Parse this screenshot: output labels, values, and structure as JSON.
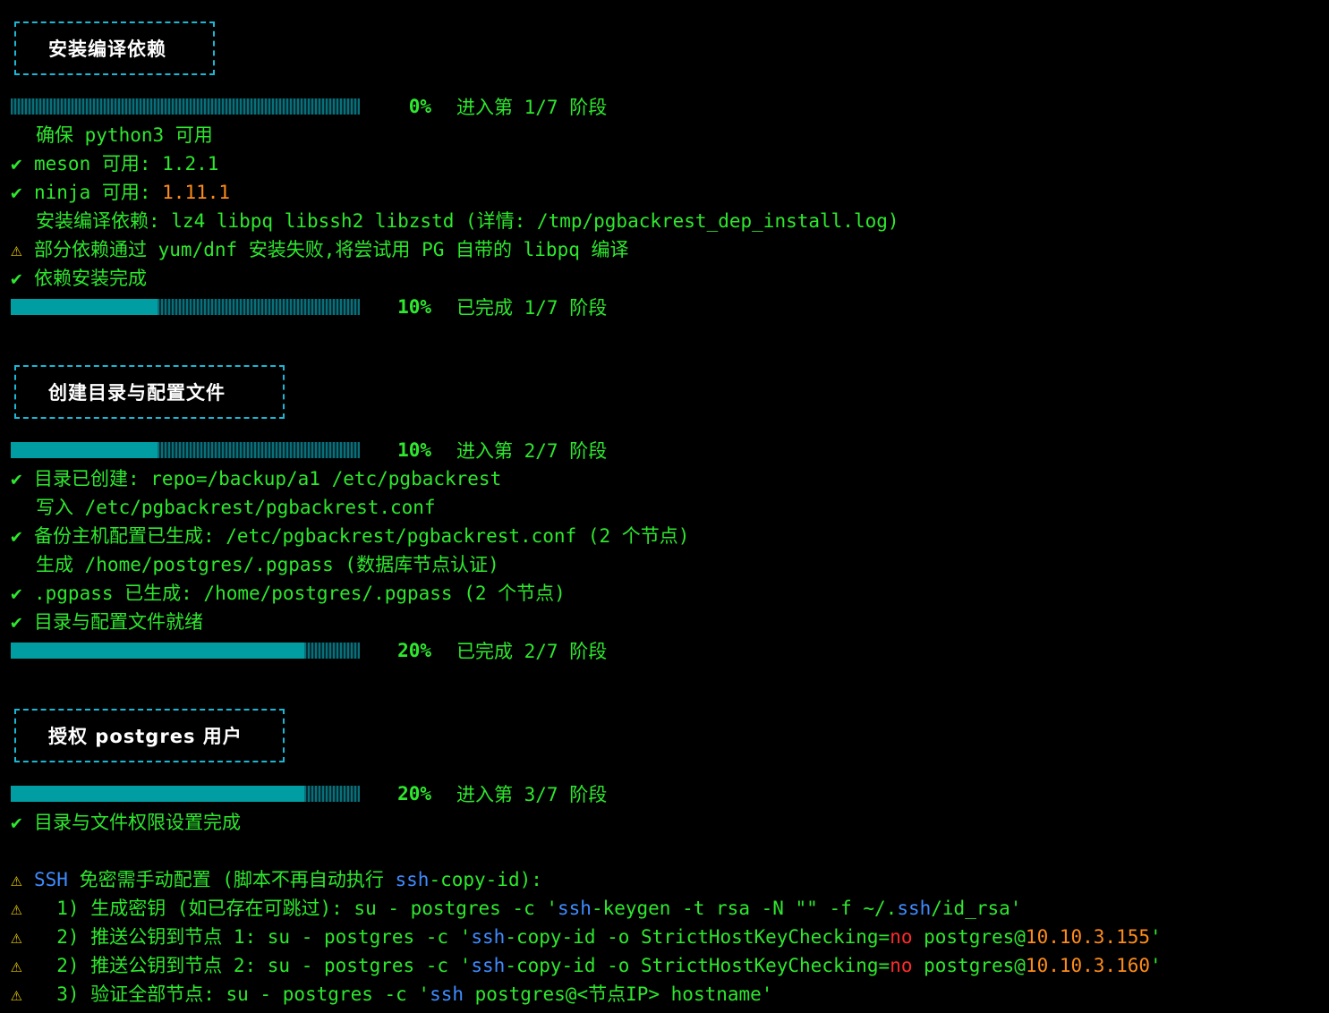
{
  "sections": {
    "s1": "安装编译依赖",
    "s2": "创建目录与配置文件",
    "s3": "授权 postgres 用户"
  },
  "progress": [
    {
      "percent": 0,
      "label": "0%",
      "text": "进入第 1/7 阶段"
    },
    {
      "percent": 10,
      "label": "10%",
      "text": "已完成 1/7 阶段"
    },
    {
      "percent": 10,
      "label": "10%",
      "text": "进入第 2/7 阶段"
    },
    {
      "percent": 20,
      "label": "20%",
      "text": "已完成 2/7 阶段"
    },
    {
      "percent": 20,
      "label": "20%",
      "text": "进入第 3/7 阶段"
    }
  ],
  "log": {
    "python": "确保 python3 可用",
    "meson_a": "meson 可用: ",
    "meson_v": "1.2.1",
    "ninja_a": "ninja 可用: ",
    "ninja_v": "1.11.1",
    "deps": "安装编译依赖: lz4 libpq libssh2 libzstd (详情: /tmp/pgbackrest_dep_install.log)",
    "yum_warn": "部分依赖通过 yum/dnf 安装失败,将尝试用 PG 自带的 libpq 编译",
    "deps_done": "依赖安装完成",
    "dir_created": "目录已创建: repo=/backup/a1 /etc/pgbackrest",
    "write_conf": "写入 /etc/pgbackrest/pgbackrest.conf",
    "conf_done": "备份主机配置已生成: /etc/pgbackrest/pgbackrest.conf (2 个节点)",
    "pgpass_gen": "生成 /home/postgres/.pgpass (数据库节点认证)",
    "pgpass_done": ".pgpass 已生成: /home/postgres/.pgpass (2 个节点)",
    "dir_ready": "目录与配置文件就绪",
    "perm_done": "目录与文件权限设置完成",
    "ssh_a": "SSH",
    "ssh_b": " 免密需手动配置 (脚本不再自动执行 ",
    "ssh_c": "ssh",
    "ssh_d": "-copy-id):",
    "step1_a": "  1) 生成密钥 (如已存在可跳过): su - postgres -c '",
    "step1_b": "ssh",
    "step1_c": "-keygen -t rsa -N \"\" -f ~/.",
    "step1_d": "ssh",
    "step1_e": "/id_rsa'",
    "step2a_a": "  2) 推送公钥到节点 1: su - postgres -c '",
    "step2a_b": "ssh",
    "step2a_c": "-copy-id -o StrictHostKeyChecking=",
    "step2a_d": "no",
    "step2a_e": " postgres@",
    "step2a_f": "10.10.3.155",
    "step2a_g": "'",
    "step2b_a": "  2) 推送公钥到节点 2: su - postgres -c '",
    "step2b_b": "ssh",
    "step2b_c": "-copy-id -o StrictHostKeyChecking=",
    "step2b_d": "no",
    "step2b_e": " postgres@",
    "step2b_f": "10.10.3.160",
    "step2b_g": "'",
    "step3_a": "  3) 验证全部节点: su - postgres -c '",
    "step3_b": "ssh",
    "step3_c": " postgres@<节点IP> hostname'"
  },
  "icons": {
    "check": "✔",
    "warn": "⚠"
  },
  "colors": {
    "green": "#2ee82e",
    "cyan": "#19b8d6",
    "orange": "#ff8c1a",
    "blue": "#3f8cff",
    "red": "#ff2a2a"
  }
}
